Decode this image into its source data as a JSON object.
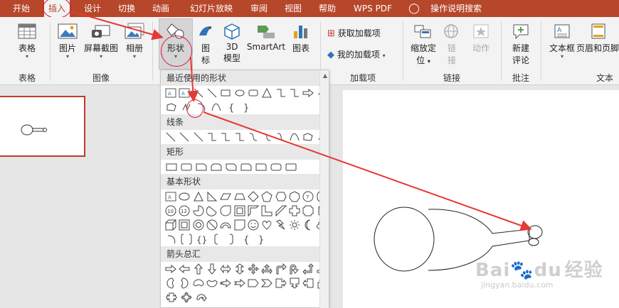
{
  "tabs": [
    "开始",
    "插入",
    "设计",
    "切换",
    "动画",
    "幻灯片放映",
    "审阅",
    "视图",
    "帮助",
    "WPS PDF"
  ],
  "active_tab": "插入",
  "tell_me": "操作说明搜索",
  "ribbon": {
    "table": "表格",
    "picture": "图片",
    "screenshot": "屏幕截图",
    "album": "相册",
    "shapes": "形状",
    "icons_top": "图",
    "icons_bottom": "标",
    "model_top": "3D",
    "model_bottom": "模型",
    "smartart": "SmartArt",
    "chart": "图表",
    "get_addins": "获取加载项",
    "my_addins": "我的加载项",
    "zoom_top": "缩放定",
    "zoom_bottom": "位",
    "link_top": "链",
    "link_bottom": "接",
    "action": "动作",
    "new_comment_top": "新建",
    "new_comment_bottom": "评论",
    "textbox": "文本框",
    "header_footer": "页眉和页脚"
  },
  "groups": {
    "table": "表格",
    "images": "图像",
    "addins": "加载项",
    "links": "链接",
    "comments": "批注",
    "text": "文本"
  },
  "gallery": {
    "recent": "最近使用的形状",
    "lines": "线条",
    "rect": "矩形",
    "basic": "基本形状",
    "arrows": "箭头总汇"
  },
  "watermark": {
    "brand": "Bai",
    "brand2": "du",
    "brand3": "经验",
    "url": "jingyan.baidu.com"
  }
}
